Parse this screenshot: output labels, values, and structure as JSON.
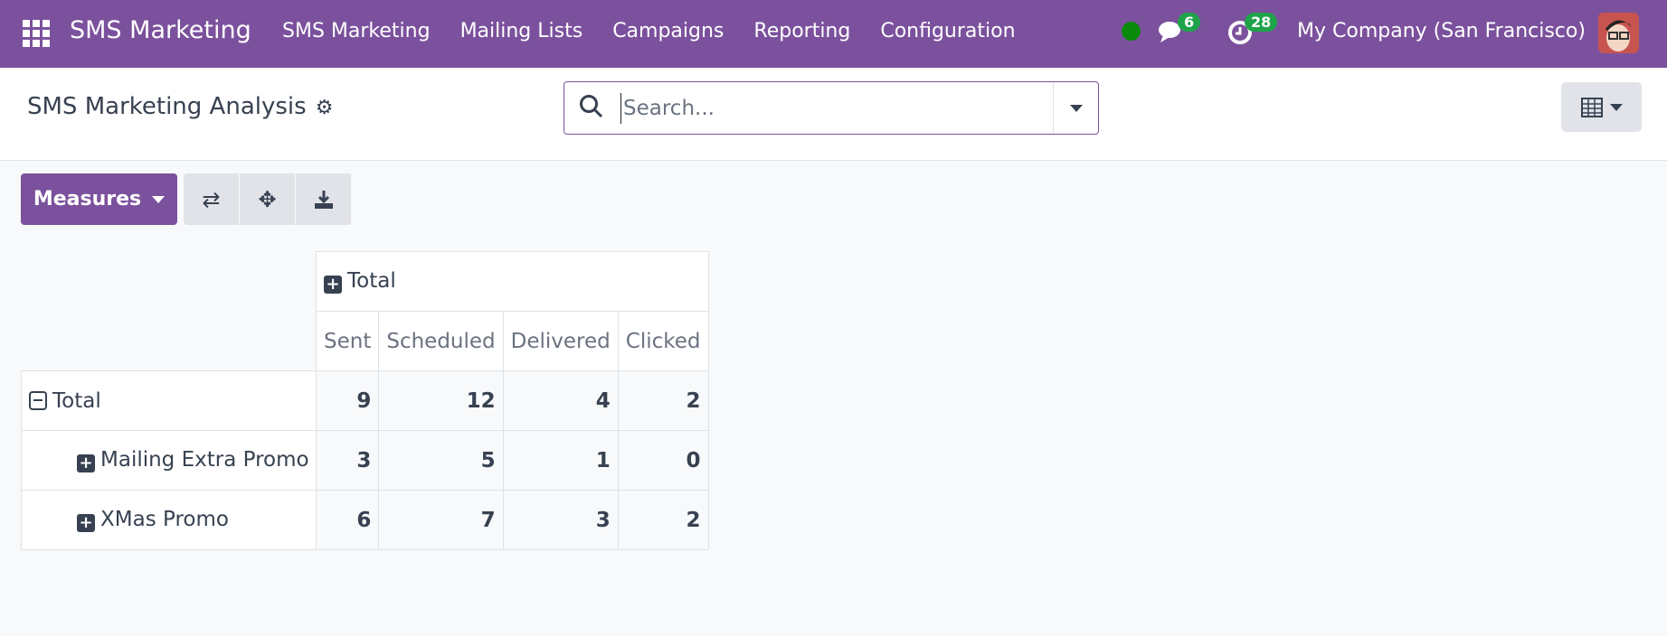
{
  "navbar": {
    "app_name": "SMS Marketing",
    "menu": [
      "SMS Marketing",
      "Mailing Lists",
      "Campaigns",
      "Reporting",
      "Configuration"
    ],
    "messages_count": "6",
    "activities_count": "28",
    "company": "My Company (San Francisco)"
  },
  "control_panel": {
    "title": "SMS Marketing Analysis",
    "search_placeholder": "Search..."
  },
  "toolbar": {
    "measures_label": "Measures"
  },
  "pivot": {
    "col_header": "Total",
    "measures": [
      "Sent",
      "Scheduled",
      "Delivered",
      "Clicked"
    ],
    "rows": [
      {
        "label": "Total",
        "values": [
          "9",
          "12",
          "4",
          "2"
        ]
      },
      {
        "label": "Mailing Extra Promo",
        "values": [
          "3",
          "5",
          "1",
          "0"
        ]
      },
      {
        "label": "XMas Promo",
        "values": [
          "6",
          "7",
          "3",
          "2"
        ]
      }
    ]
  },
  "colors": {
    "brand": "#7b519d",
    "badge": "#1fa34a"
  }
}
